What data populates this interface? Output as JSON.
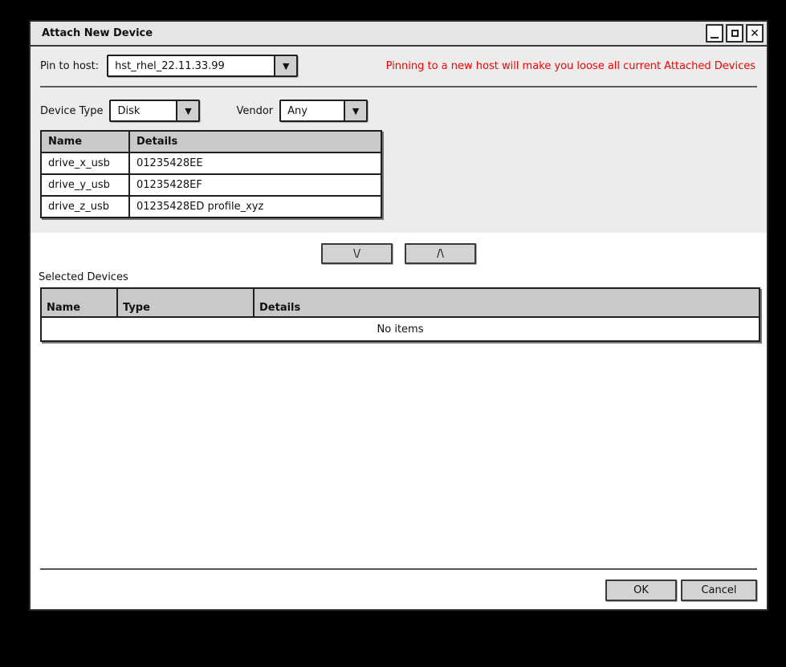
{
  "window": {
    "title": "Attach New Device"
  },
  "icons": {
    "dropdown_arrow": "▼",
    "close": "✕"
  },
  "pin_section": {
    "label": "Pin to host:",
    "host_value": "hst_rhel_22.11.33.99",
    "warning": "Pinning to a new host will make you loose all current Attached Devices"
  },
  "filters": {
    "device_type_label": "Device Type",
    "device_type_value": "Disk",
    "vendor_label": "Vendor",
    "vendor_value": "Any"
  },
  "available_devices": {
    "columns": [
      "Name",
      "Details"
    ],
    "rows": [
      {
        "name": "drive_x_usb",
        "details": "01235428EE"
      },
      {
        "name": "drive_y_usb",
        "details": "01235428EF"
      },
      {
        "name": "drive_z_usb",
        "details": "01235428ED profile_xyz"
      }
    ]
  },
  "transfer": {
    "move_down_label": "\\/",
    "move_up_label": "/\\"
  },
  "selected_devices": {
    "label": "Selected Devices",
    "columns": [
      "Name",
      "Type",
      "Details"
    ],
    "empty_text": "No items"
  },
  "footer": {
    "ok_label": "OK",
    "cancel_label": "Cancel"
  },
  "colors": {
    "warning_text": "#ff0000",
    "panel_bg": "#ececec",
    "table_header_bg": "#c9c9c9",
    "button_bg": "#d3d3d3"
  }
}
